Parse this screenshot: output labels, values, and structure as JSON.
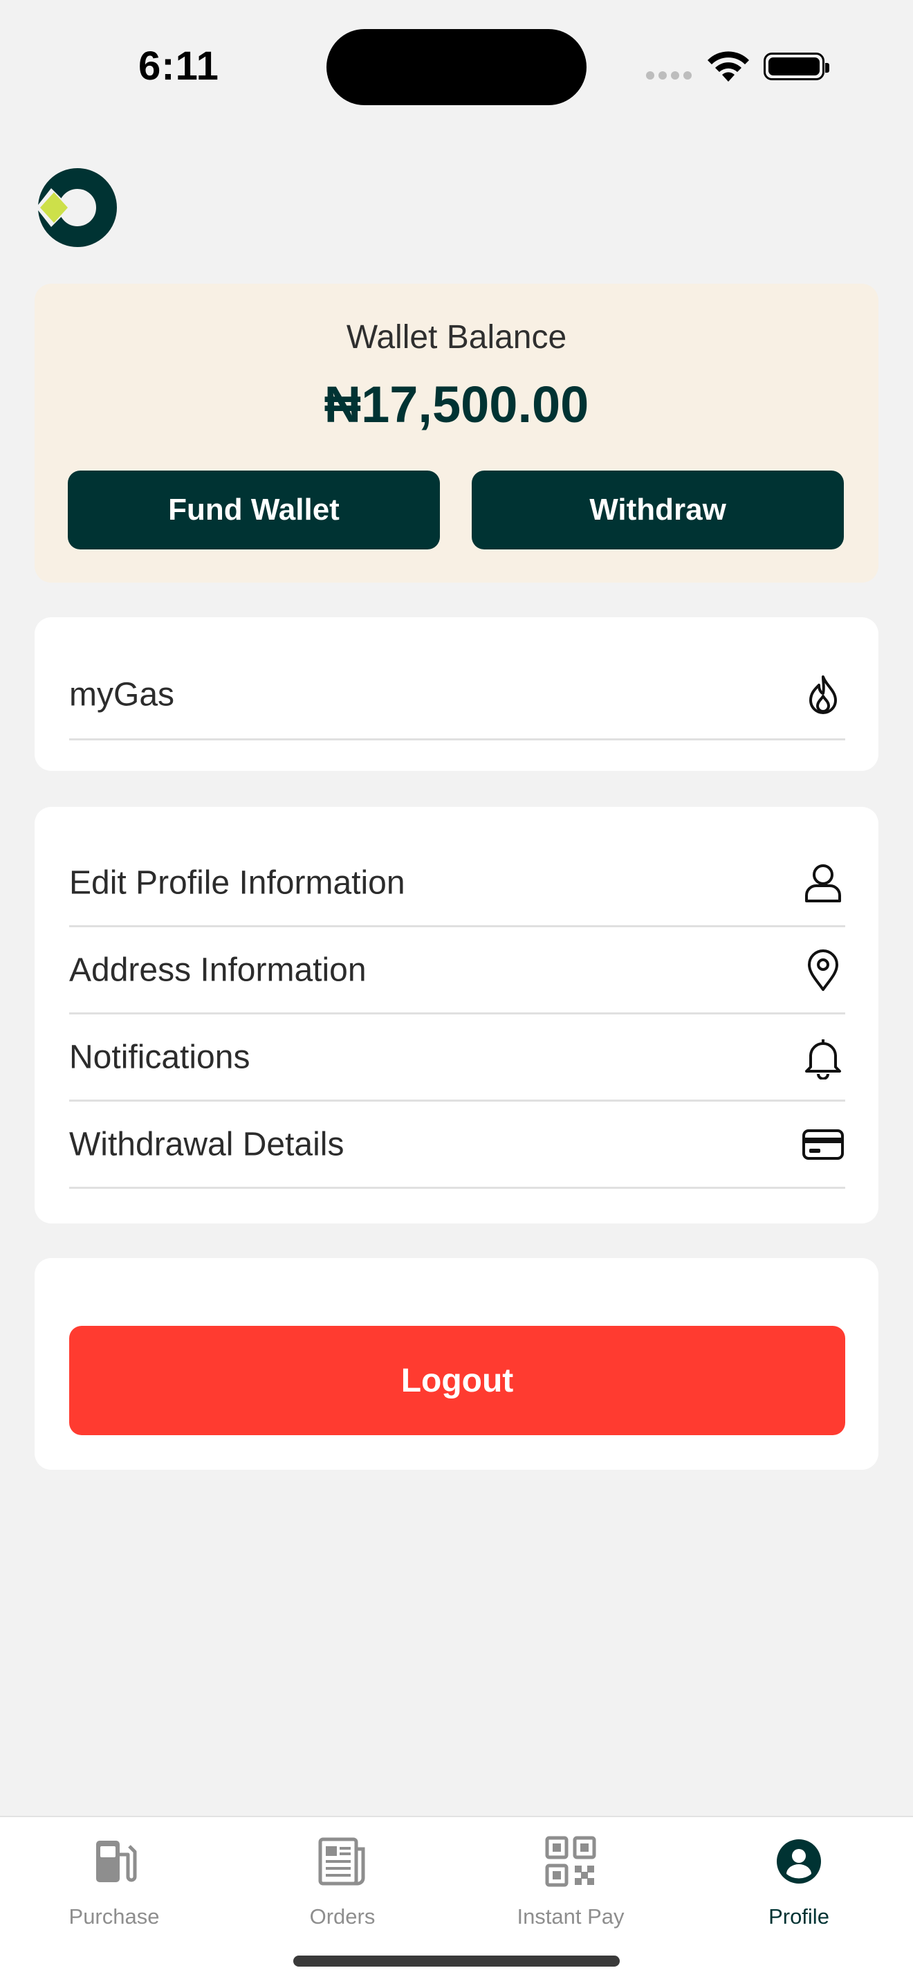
{
  "status_bar": {
    "time": "6:11"
  },
  "wallet": {
    "label": "Wallet Balance",
    "amount": "₦17,500.00",
    "fund_label": "Fund Wallet",
    "withdraw_label": "Withdraw"
  },
  "gas_card": {
    "label": "myGas",
    "icon": "flame-icon"
  },
  "menu": {
    "items": [
      {
        "label": "Edit Profile Information",
        "icon": "user-icon"
      },
      {
        "label": "Address Information",
        "icon": "location-pin-icon"
      },
      {
        "label": "Notifications",
        "icon": "bell-icon"
      },
      {
        "label": "Withdrawal Details",
        "icon": "credit-card-icon"
      }
    ]
  },
  "logout": {
    "label": "Logout"
  },
  "tabs": [
    {
      "label": "Purchase",
      "icon": "fuel-pump-icon",
      "active": false
    },
    {
      "label": "Orders",
      "icon": "newspaper-icon",
      "active": false
    },
    {
      "label": "Instant Pay",
      "icon": "qr-code-icon",
      "active": false
    },
    {
      "label": "Profile",
      "icon": "profile-icon",
      "active": true
    }
  ],
  "colors": {
    "primary": "#003333",
    "accent": "#cde04a",
    "danger": "#ff3b30",
    "wallet_bg": "#f8f0e4",
    "page_bg": "#f2f2f2"
  }
}
